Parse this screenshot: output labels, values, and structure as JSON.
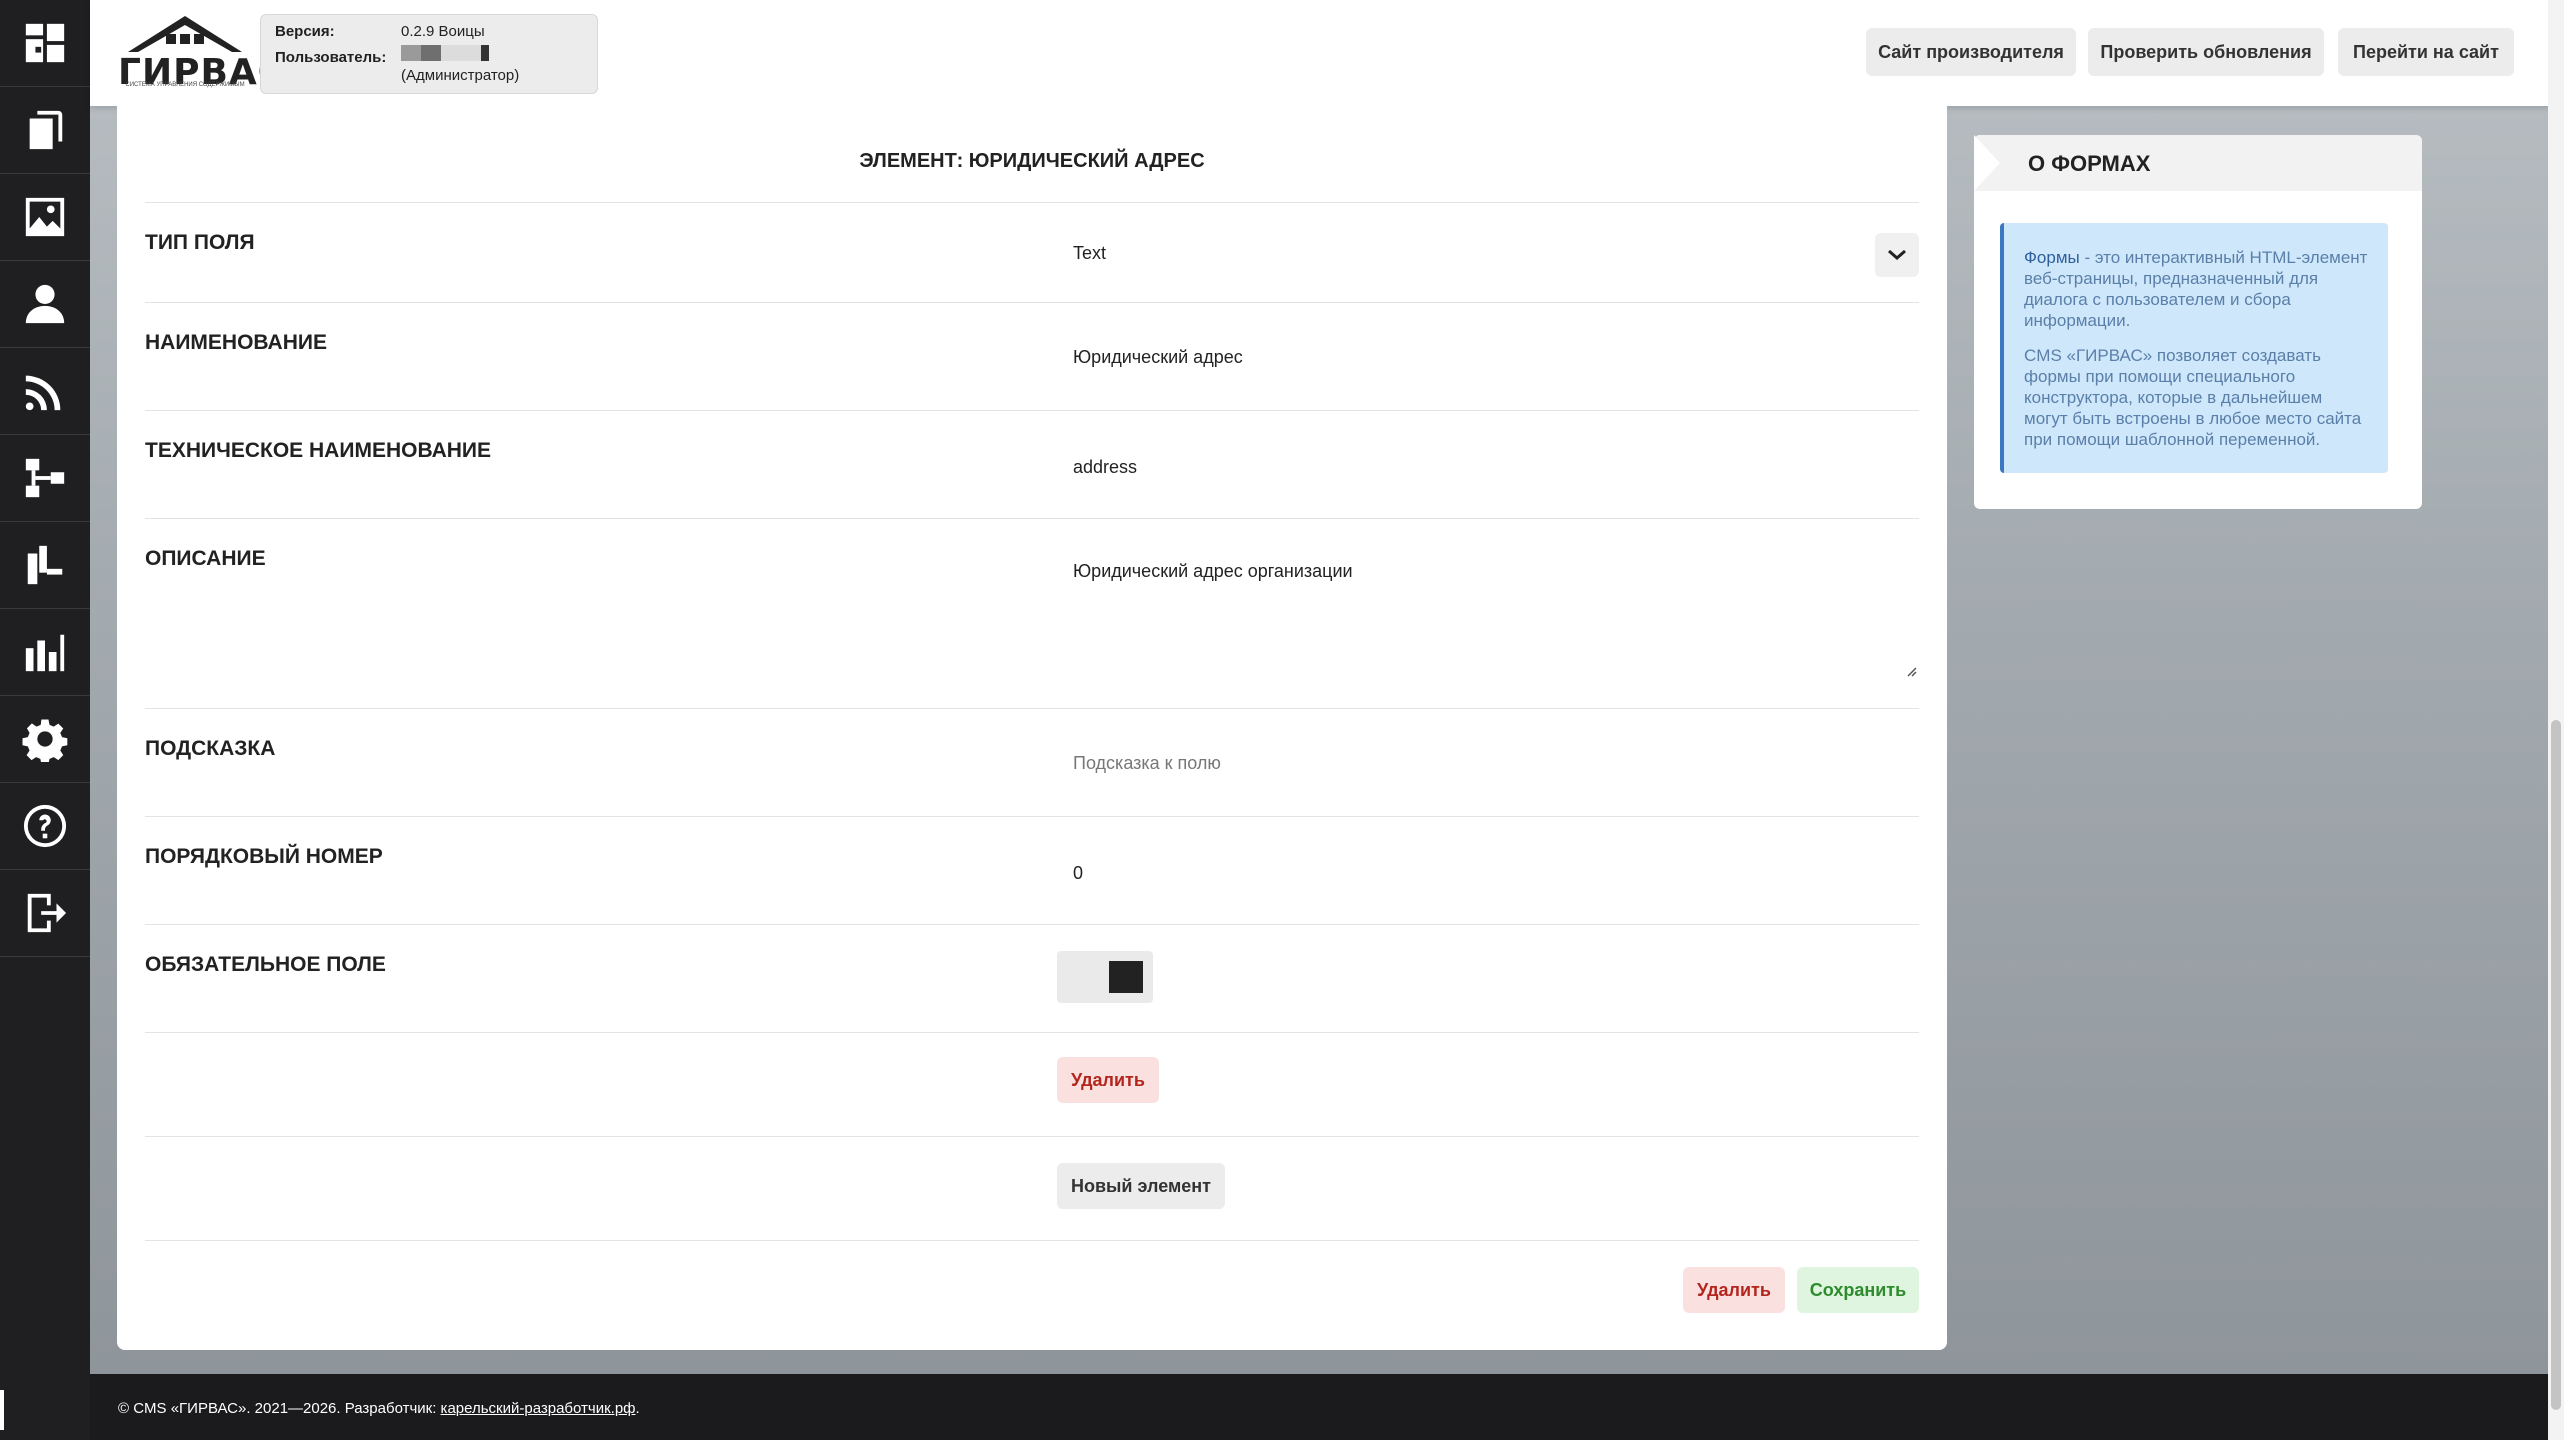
{
  "header": {
    "logo_title": "ГИРВАС",
    "logo_subtitle": "СИСТЕМА УПРАВЛЕНИЯ СОДЕРЖИМЫМ",
    "version_label": "Версия:",
    "version_value": "0.2.9 Воицы",
    "user_label": "Пользователь:",
    "user_role": "(Администратор)",
    "buttons": {
      "vendor_site": "Сайт производителя",
      "check_updates": "Проверить обновления",
      "go_to_site": "Перейти на сайт"
    }
  },
  "sidebar": {
    "items": [
      {
        "icon": "dashboard-icon"
      },
      {
        "icon": "pages-icon"
      },
      {
        "icon": "image-icon"
      },
      {
        "icon": "user-icon"
      },
      {
        "icon": "feed-icon"
      },
      {
        "icon": "structure-icon"
      },
      {
        "icon": "modules-icon"
      },
      {
        "icon": "stats-icon"
      },
      {
        "icon": "settings-icon"
      },
      {
        "icon": "help-icon"
      },
      {
        "icon": "logout-icon"
      }
    ]
  },
  "form": {
    "title": "ЭЛЕМЕНТ: ЮРИДИЧЕСКИЙ АДРЕС",
    "field_type_label": "ТИП ПОЛЯ",
    "field_type_value": "Text",
    "name_label": "НАИМЕНОВАНИЕ",
    "name_value": "Юридический адрес",
    "tech_name_label": "ТЕХНИЧЕСКОЕ НАИМЕНОВАНИЕ",
    "tech_name_value": "address",
    "description_label": "ОПИСАНИЕ",
    "description_value": "Юридический адрес организации",
    "hint_label": "ПОДСКАЗКА",
    "hint_placeholder": "Подсказка к полю",
    "order_label": "ПОРЯДКОВЫЙ НОМЕР",
    "order_value": "0",
    "required_label": "ОБЯЗАТЕЛЬНОЕ ПОЛЕ",
    "required_value": true,
    "delete_element_button": "Удалить",
    "new_element_button": "Новый элемент",
    "delete_button": "Удалить",
    "save_button": "Сохранить"
  },
  "about": {
    "title": "О ФОРМАХ",
    "para1_bold": "Формы",
    "para1_rest": " - это интерактивный HTML-элемент веб-страницы, предназначенный для диалога с пользователем и сбора информации.",
    "para2": "CMS «ГИРВАС» позволяет создавать формы при помощи специального конструктора, которые в дальнейшем могут быть встроены в любое место сайта при помощи шаблонной переменной."
  },
  "footer": {
    "copyright": "© CMS «ГИРВАС». 2021—2026. Разработчик: ",
    "developer_link": "карельский-разработчик.рф",
    "end": "."
  },
  "colors": {
    "sidebar_bg": "#1f1f21",
    "danger": "#b3261e",
    "success": "#2e8b2e",
    "info_bg": "#cfe7fb",
    "info_border": "#3a78c2"
  }
}
